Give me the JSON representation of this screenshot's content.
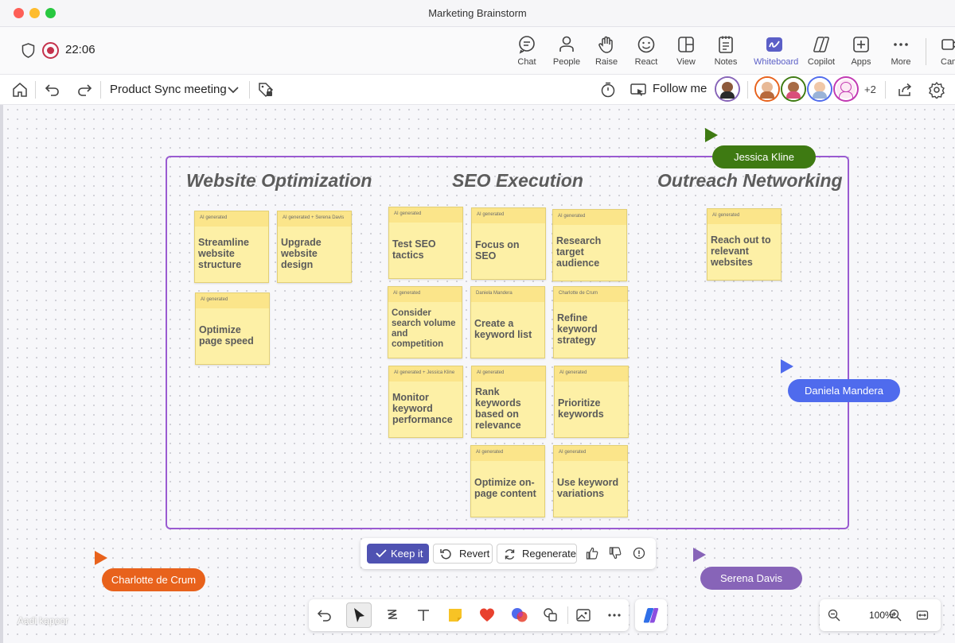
{
  "window": {
    "title": "Marketing Brainstorm"
  },
  "meeting": {
    "timer": "22:06",
    "buttons": [
      {
        "label": "Chat",
        "icon": "chat-icon"
      },
      {
        "label": "People",
        "icon": "people-icon"
      },
      {
        "label": "Raise",
        "icon": "raise-hand-icon"
      },
      {
        "label": "React",
        "icon": "react-icon"
      },
      {
        "label": "View",
        "icon": "view-icon"
      },
      {
        "label": "Notes",
        "icon": "notes-icon"
      },
      {
        "label": "Whiteboard",
        "icon": "whiteboard-icon",
        "active": true
      },
      {
        "label": "Copilot",
        "icon": "copilot-icon"
      },
      {
        "label": "Apps",
        "icon": "apps-icon"
      },
      {
        "label": "More",
        "icon": "more-icon"
      },
      {
        "label": "Cam",
        "icon": "camera-icon"
      }
    ],
    "accent_color": "#5b5fc7"
  },
  "toolbar": {
    "meeting_name": "Product Sync meeting",
    "follow_label": "Follow me",
    "extra_participants": "+2"
  },
  "board": {
    "columns": [
      "Website Optimization",
      "SEO Execution",
      "Outreach Networking"
    ],
    "notes": [
      {
        "tag": "AI generated",
        "text": "Streamline website structure"
      },
      {
        "tag": "AI generated + Serena Davis",
        "text": "Upgrade website design"
      },
      {
        "tag": "AI generated",
        "text": "Optimize page speed"
      },
      {
        "tag": "AI generated",
        "text": "Test SEO tactics"
      },
      {
        "tag": "AI generated",
        "text": "Focus on SEO"
      },
      {
        "tag": "AI generated",
        "text": "Research target audience"
      },
      {
        "tag": "AI generated",
        "text": "Consider search volume and competition"
      },
      {
        "tag": "Daniela Mandera",
        "text": "Create a keyword list"
      },
      {
        "tag": "Charlotte de Crum",
        "text": "Refine keyword strategy"
      },
      {
        "tag": "AI generated + Jessica Kline",
        "text": "Monitor keyword performance"
      },
      {
        "tag": "AI generated",
        "text": "Rank keywords based on relevance"
      },
      {
        "tag": "AI generated",
        "text": "Prioritize keywords"
      },
      {
        "tag": "AI generated",
        "text": "Optimize on-page content"
      },
      {
        "tag": "AI generated",
        "text": "Use keyword variations"
      },
      {
        "tag": "AI generated",
        "text": "Reach out to relevant websites"
      }
    ]
  },
  "cursors": [
    {
      "name": "Jessica Kline",
      "color": "#3e7a12"
    },
    {
      "name": "Daniela Mandera",
      "color": "#4f6bed"
    },
    {
      "name": "Charlotte de Crum",
      "color": "#e8621c"
    },
    {
      "name": "Serena Davis",
      "color": "#8764b8"
    }
  ],
  "ai_actions": {
    "keep": "Keep it",
    "revert": "Revert",
    "regenerate": "Regenerate"
  },
  "zoom": {
    "level": "100%"
  },
  "self_view": {
    "name": "Aadi kapoor"
  }
}
